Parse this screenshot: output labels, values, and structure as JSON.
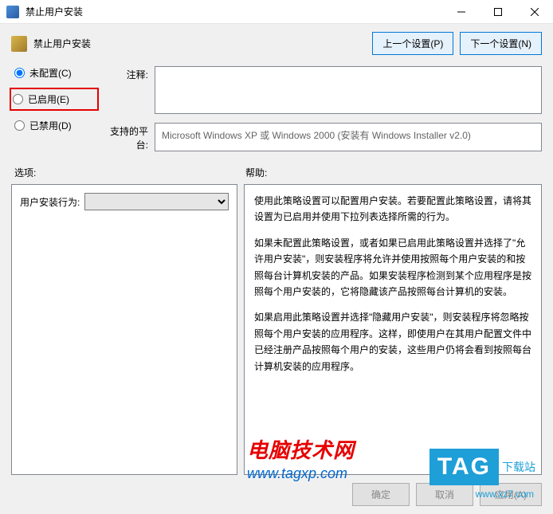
{
  "titlebar": {
    "title": "禁止用户安装"
  },
  "header": {
    "title": "禁止用户安装",
    "prev": "上一个设置(P)",
    "next": "下一个设置(N)"
  },
  "radios": {
    "not_configured": "未配置(C)",
    "enabled": "已启用(E)",
    "disabled": "已禁用(D)"
  },
  "labels": {
    "comment": "注释:",
    "platform": "支持的平台:",
    "options": "选项:",
    "help": "帮助:",
    "behavior": "用户安装行为:"
  },
  "platform_text": "Microsoft Windows XP 或 Windows 2000 (安装有 Windows Installer v2.0)",
  "help": {
    "p1": "使用此策略设置可以配置用户安装。若要配置此策略设置，请将其设置为已启用并使用下拉列表选择所需的行为。",
    "p2": "如果未配置此策略设置，或者如果已启用此策略设置并选择了\"允许用户安装\"，则安装程序将允许并使用按照每个用户安装的和按照每台计算机安装的产品。如果安装程序检测到某个应用程序是按照每个用户安装的，它将隐藏该产品按照每台计算机的安装。",
    "p3": "如果启用此策略设置并选择\"隐藏用户安装\"，则安装程序将忽略按照每个用户安装的应用程序。这样，即使用户在其用户配置文件中已经注册产品按照每个用户的安装，这些用户仍将会看到按照每台计算机安装的应用程序。"
  },
  "buttons": {
    "ok": "确定",
    "cancel": "取消",
    "apply": "应用(A)"
  },
  "watermark": {
    "line1": "电脑技术网",
    "line2": "www.tagxp.com",
    "tag": "TAG",
    "tag_text": "下载站",
    "tag_sub": "www.xz7.com"
  }
}
